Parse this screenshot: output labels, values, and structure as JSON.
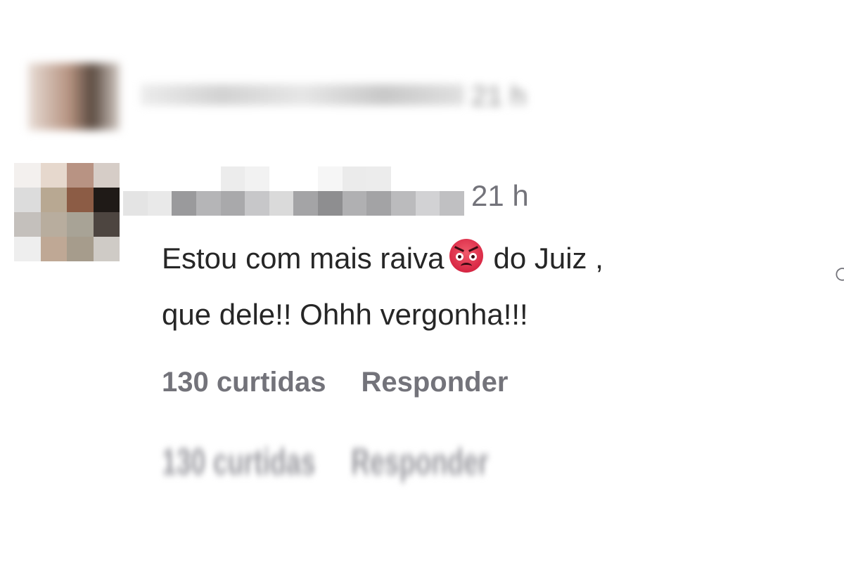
{
  "previous_comment": {
    "timestamp": "21 h"
  },
  "comment": {
    "timestamp": "21 h",
    "text_line1_before_emoji": "Estou com mais raiva",
    "emoji": "angry-face-emoji",
    "text_line1_after_emoji": "do Juiz ,",
    "text_line2": "que dele!! Ohhh vergonha!!!",
    "likes_label": "130 curtidas",
    "reply_label": "Responder"
  },
  "ghost_actions": {
    "likes_label": "130 curtidas",
    "reply_label": "Responder"
  },
  "icons": {
    "more": "more-options-icon"
  },
  "colors": {
    "text_primary": "#262626",
    "text_secondary": "#73737a",
    "emoji_red": "#d92845"
  }
}
